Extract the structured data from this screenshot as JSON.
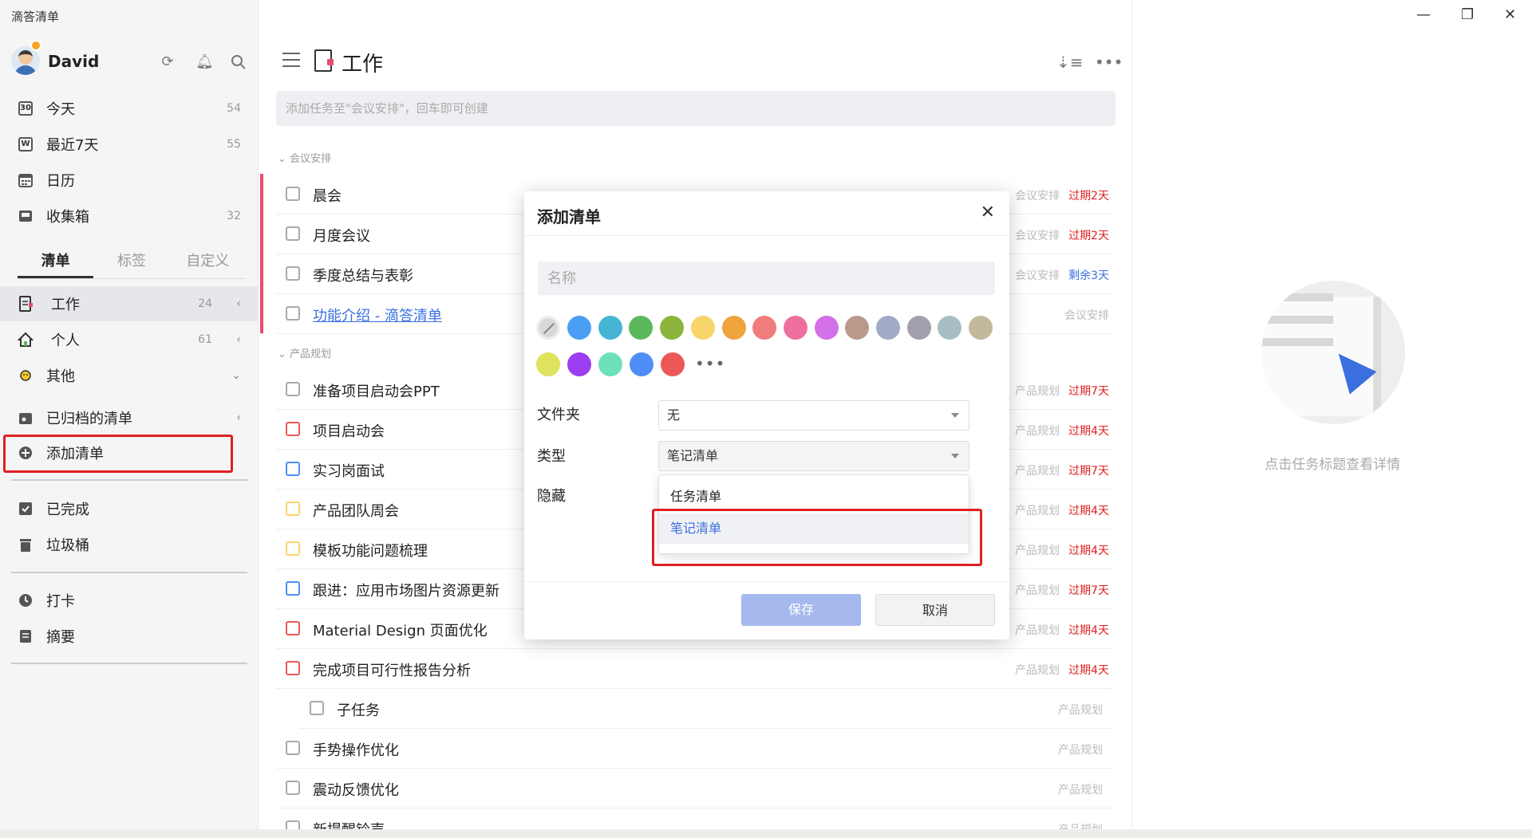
{
  "app": {
    "title": "滴答清单"
  },
  "user": {
    "name": "David"
  },
  "sidebar": {
    "smart": [
      {
        "label": "今天",
        "count": "54",
        "icon": "calendar-today-icon",
        "badge": "30"
      },
      {
        "label": "最近7天",
        "count": "55",
        "icon": "week-icon",
        "badge": "W"
      },
      {
        "label": "日历",
        "count": "",
        "icon": "calendar-icon"
      },
      {
        "label": "收集箱",
        "count": "32",
        "icon": "inbox-icon"
      }
    ],
    "tabs": [
      "清单",
      "标签",
      "自定义"
    ],
    "lists": [
      {
        "label": "工作",
        "count": "24"
      },
      {
        "label": "个人",
        "count": "61"
      },
      {
        "label": "其他",
        "count": ""
      }
    ],
    "archived": "已归档的清单",
    "add_list": "添加清单",
    "completed": "已完成",
    "trash": "垃圾桶",
    "checkin": "打卡",
    "summary": "摘要"
  },
  "main": {
    "title": "工作",
    "add_placeholder": "添加任务至\"会议安排\"，回车即可创建",
    "sections": [
      {
        "title": "会议安排"
      },
      {
        "title": "产品规划"
      }
    ],
    "tasks": [
      {
        "title": "晨会",
        "list": "会议安排",
        "due": "过期2天"
      },
      {
        "title": "月度会议",
        "list": "会议安排",
        "due": "过期2天"
      },
      {
        "title": "季度总结与表彰",
        "list": "会议安排",
        "due": "剩余3天"
      },
      {
        "title": "功能介绍 - 滴答清单",
        "list": "会议安排",
        "due": ""
      },
      {
        "title": "准备项目启动会PPT",
        "list": "产品规划",
        "due": "过期7天"
      },
      {
        "title": "项目启动会",
        "list": "产品规划",
        "due": "过期4天"
      },
      {
        "title": "实习岗面试",
        "list": "产品规划",
        "due": "过期7天"
      },
      {
        "title": "产品团队周会",
        "list": "产品规划",
        "due": "过期4天"
      },
      {
        "title": "模板功能问题梳理",
        "list": "产品规划",
        "due": "过期4天"
      },
      {
        "title": "跟进：应用市场图片资源更新",
        "list": "产品规划",
        "due": "过期7天"
      },
      {
        "title": "Material Design 页面优化",
        "list": "产品规划",
        "due": "过期4天"
      },
      {
        "title": "完成项目可行性报告分析",
        "list": "产品规划",
        "due": "过期4天"
      },
      {
        "title": "子任务",
        "list": "产品规划",
        "due": ""
      },
      {
        "title": "手势操作优化",
        "list": "产品规划",
        "due": ""
      },
      {
        "title": "震动反馈优化",
        "list": "产品规划",
        "due": ""
      },
      {
        "title": "新提醒铃声",
        "list": "产品规划",
        "due": ""
      }
    ]
  },
  "detail": {
    "empty_text": "点击任务标题查看详情"
  },
  "modal": {
    "title": "添加清单",
    "name_placeholder": "名称",
    "folder_label": "文件夹",
    "folder_value": "无",
    "type_label": "类型",
    "type_value": "笔记清单",
    "hidden_label": "隐藏",
    "type_options": [
      "任务清单",
      "笔记清单"
    ],
    "save": "保存",
    "cancel": "取消",
    "colors_row1": [
      "#4a9ff5",
      "#45b5d3",
      "#5cb85c",
      "#8cb43c",
      "#f7d56b",
      "#f0a43e",
      "#f07c7c",
      "#ef6ea0",
      "#d36fe8",
      "#b99a8a",
      "#a3aac8",
      "#a3a0ae",
      "#a8bec4",
      "#c2b89c"
    ],
    "colors_row2": [
      "#dde35c",
      "#9b3df0",
      "#6ee0b8",
      "#4f8ef5",
      "#ec5858"
    ]
  },
  "colors": {
    "accent": "#3b6fe0",
    "overdue": "#e02020",
    "highlight_box": "#e02020"
  }
}
